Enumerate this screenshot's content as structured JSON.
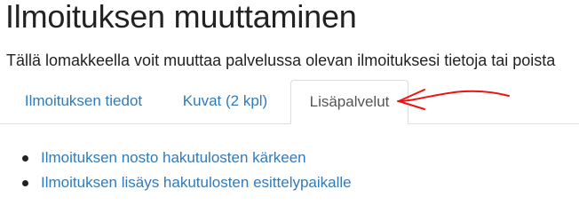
{
  "page": {
    "title": "Ilmoituksen muuttaminen",
    "lead": "Tällä lomakkeella voit muuttaa palvelussa olevan ilmoituksesi tietoja tai poista"
  },
  "tabs": [
    {
      "label": "Ilmoituksen tiedot",
      "active": false
    },
    {
      "label": "Kuvat (2 kpl)",
      "active": false
    },
    {
      "label": "Lisäpalvelut",
      "active": true
    }
  ],
  "services": [
    {
      "label": "Ilmoituksen nosto hakutulosten kärkeen"
    },
    {
      "label": "Ilmoituksen lisäys hakutulosten esittelypaikalle"
    }
  ],
  "annotation": {
    "icon": "red-arrow-icon",
    "color": "#ee1111"
  },
  "colors": {
    "link": "#337ab7",
    "tab_border": "#dddddd",
    "active_tab_text": "#555555"
  }
}
